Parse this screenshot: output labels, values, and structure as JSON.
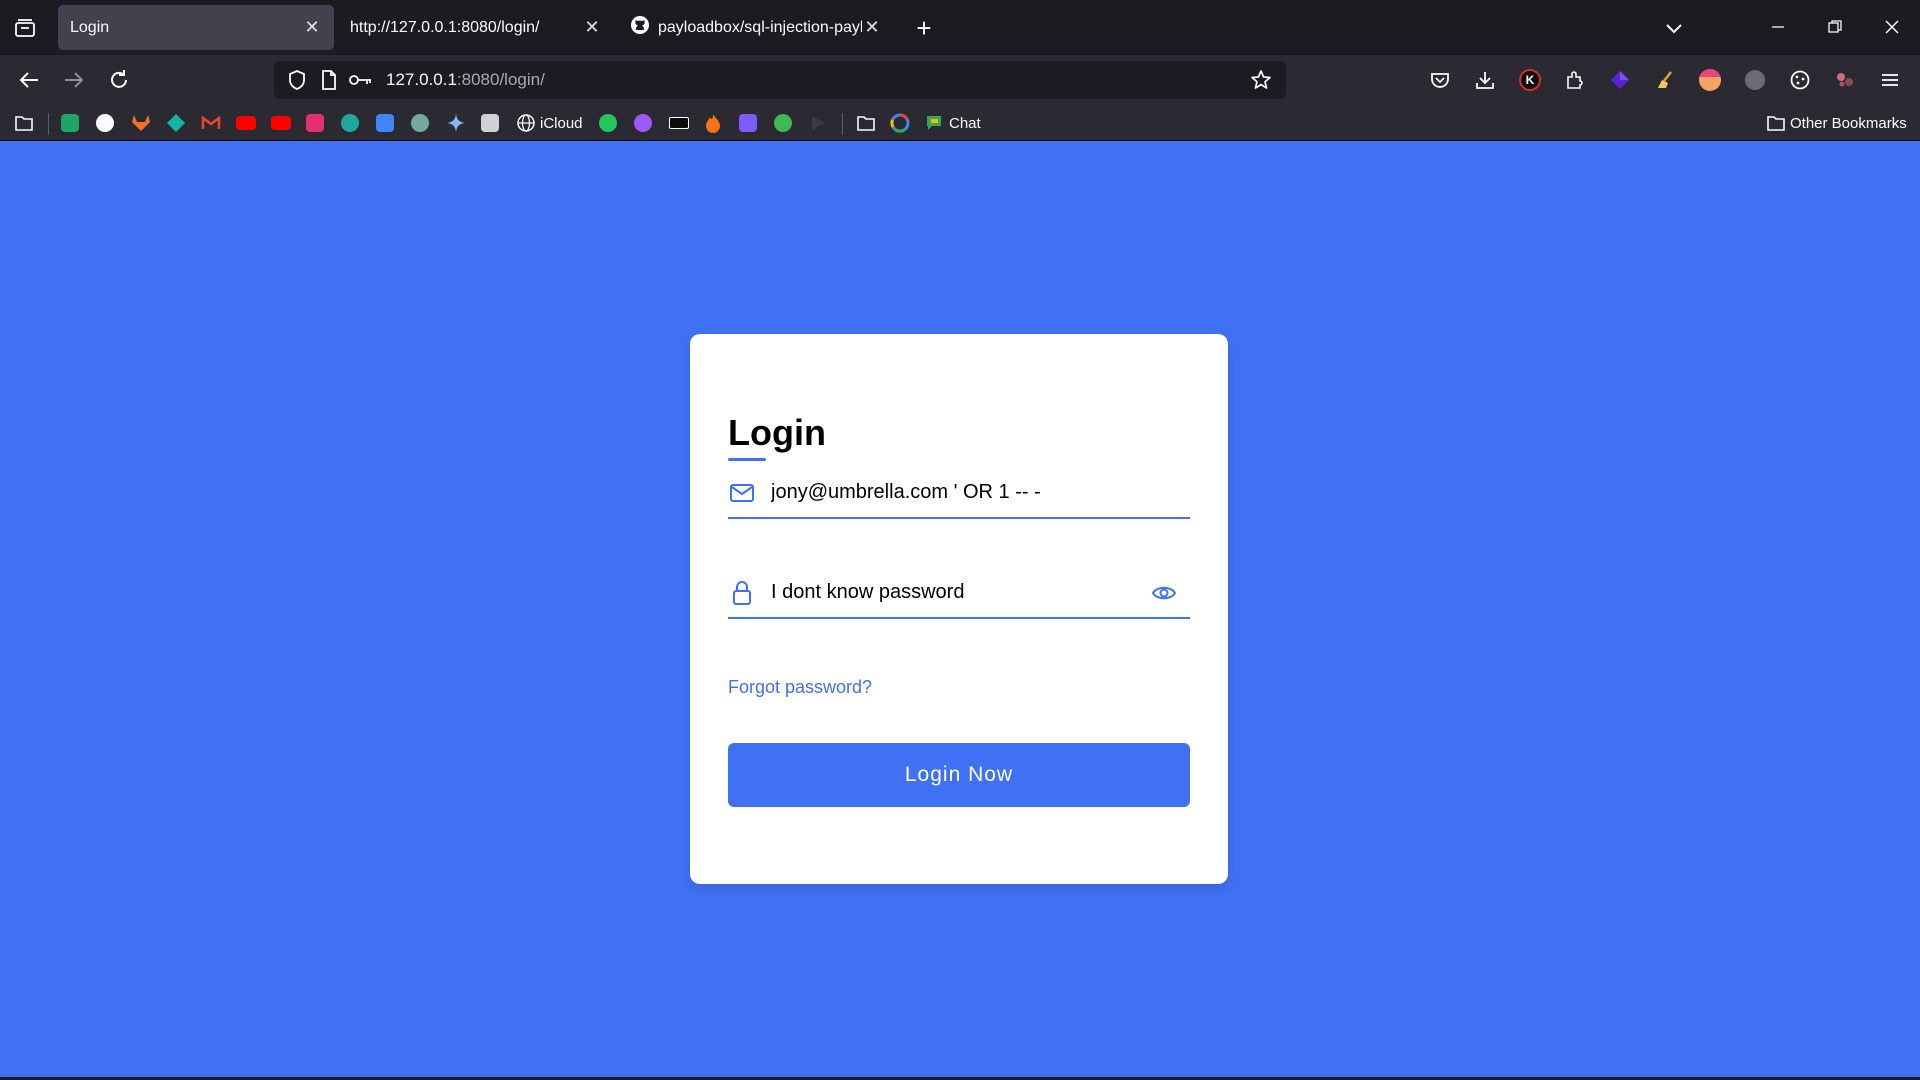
{
  "browser": {
    "tabs": [
      {
        "title": "Login",
        "active": true
      },
      {
        "title": "http://127.0.0.1:8080/login/",
        "active": false
      },
      {
        "title": "payloadbox/sql-injection-payload-list",
        "active": false
      }
    ],
    "url": {
      "host": "127.0.0.1",
      "rest": ":8080/login/"
    },
    "bookmarks": {
      "icloud_label": "iCloud",
      "chat_label": "Chat",
      "other_label": "Other Bookmarks"
    },
    "extension_badge": "K"
  },
  "colors": {
    "page_bg": "#4070f4",
    "accent": "#4070f4",
    "card_bg": "#ffffff",
    "chrome_dark": "#1c1b22",
    "chrome_toolbar": "#2b2a33"
  },
  "login": {
    "title": "Login",
    "email_value": "jony@umbrella.com ' OR 1 -- -",
    "password_value": "I dont know password",
    "forgot_label": "Forgot password?",
    "submit_label": "Login Now"
  }
}
